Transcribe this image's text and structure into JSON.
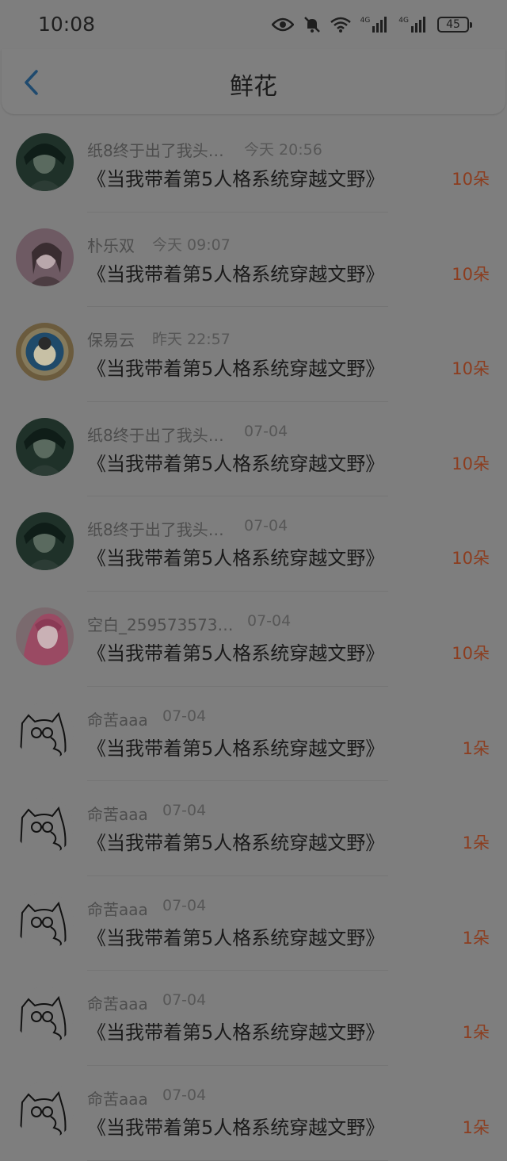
{
  "status": {
    "time": "10:08",
    "battery": "45",
    "signal_label_1": "4G",
    "signal_label_2": "4G"
  },
  "header": {
    "title": "鲜花"
  },
  "items": [
    {
      "name": "纸8终于出了我头…",
      "time": "今天 20:56",
      "work": "《当我带着第5人格系统穿越文野》",
      "flowers": "10朵"
    },
    {
      "name": "朴乐双",
      "time": "今天 09:07",
      "work": "《当我带着第5人格系统穿越文野》",
      "flowers": "10朵"
    },
    {
      "name": "保易云",
      "time": "昨天 22:57",
      "work": "《当我带着第5人格系统穿越文野》",
      "flowers": "10朵"
    },
    {
      "name": "纸8终于出了我头…",
      "time": "07-04",
      "work": "《当我带着第5人格系统穿越文野》",
      "flowers": "10朵"
    },
    {
      "name": "纸8终于出了我头…",
      "time": "07-04",
      "work": "《当我带着第5人格系统穿越文野》",
      "flowers": "10朵"
    },
    {
      "name": "空白_259573573…",
      "time": "07-04",
      "work": "《当我带着第5人格系统穿越文野》",
      "flowers": "10朵"
    },
    {
      "name": "命苦aaa",
      "time": "07-04",
      "work": "《当我带着第5人格系统穿越文野》",
      "flowers": "1朵"
    },
    {
      "name": "命苦aaa",
      "time": "07-04",
      "work": "《当我带着第5人格系统穿越文野》",
      "flowers": "1朵"
    },
    {
      "name": "命苦aaa",
      "time": "07-04",
      "work": "《当我带着第5人格系统穿越文野》",
      "flowers": "1朵"
    },
    {
      "name": "命苦aaa",
      "time": "07-04",
      "work": "《当我带着第5人格系统穿越文野》",
      "flowers": "1朵"
    },
    {
      "name": "命苦aaa",
      "time": "07-04",
      "work": "《当我带着第5人格系统穿越文野》",
      "flowers": "1朵"
    }
  ]
}
